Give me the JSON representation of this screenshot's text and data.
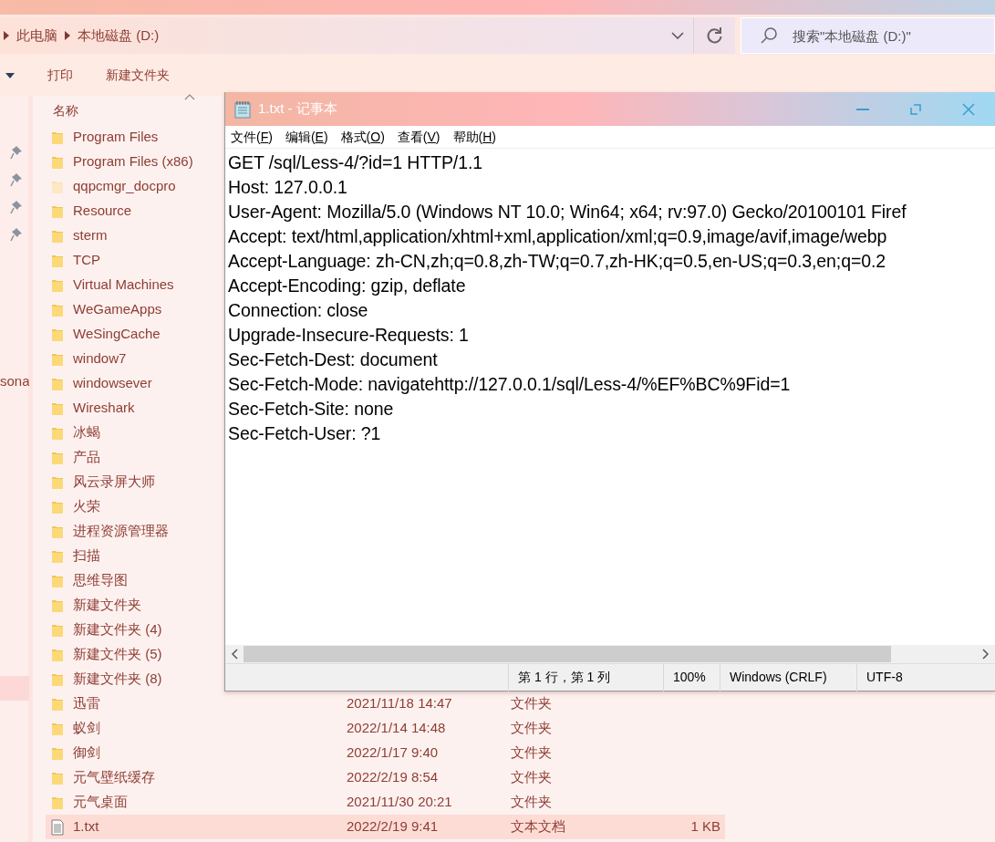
{
  "explorer": {
    "breadcrumb": [
      {
        "label": "此电脑"
      },
      {
        "label": "本地磁盘 (D:)"
      }
    ],
    "search": {
      "placeholder": "搜索\"本地磁盘 (D:)\""
    },
    "toolbar": [
      "打印",
      "新建文件夹"
    ],
    "nav_items": [
      {
        "label": "sona",
        "selected": false
      },
      {
        "selected": true
      }
    ],
    "column_header": "名称",
    "files": [
      {
        "name": "Program Files",
        "kind": "folder",
        "hidden": false,
        "selected": false
      },
      {
        "name": "Program Files (x86)",
        "kind": "folder",
        "hidden": false,
        "selected": false
      },
      {
        "name": "qqpcmgr_docpro",
        "kind": "folder",
        "hidden": true,
        "selected": false
      },
      {
        "name": "Resource",
        "kind": "folder",
        "hidden": false,
        "selected": false
      },
      {
        "name": "sterm",
        "kind": "folder",
        "hidden": false,
        "selected": false
      },
      {
        "name": "TCP",
        "kind": "folder",
        "hidden": false,
        "selected": false
      },
      {
        "name": "Virtual Machines",
        "kind": "folder",
        "hidden": false,
        "selected": false
      },
      {
        "name": "WeGameApps",
        "kind": "folder",
        "hidden": false,
        "selected": false
      },
      {
        "name": "WeSingCache",
        "kind": "folder",
        "hidden": false,
        "selected": false
      },
      {
        "name": "window7",
        "kind": "folder",
        "hidden": false,
        "selected": false
      },
      {
        "name": "windowsever",
        "kind": "folder",
        "hidden": false,
        "selected": false
      },
      {
        "name": "Wireshark",
        "kind": "folder",
        "hidden": false,
        "selected": false
      },
      {
        "name": "冰蝎",
        "kind": "folder",
        "hidden": false,
        "selected": false
      },
      {
        "name": "产品",
        "kind": "folder",
        "hidden": false,
        "selected": false
      },
      {
        "name": "风云录屏大师",
        "kind": "folder",
        "hidden": false,
        "selected": false
      },
      {
        "name": "火荣",
        "kind": "folder",
        "hidden": false,
        "selected": false
      },
      {
        "name": "进程资源管理器",
        "kind": "folder",
        "hidden": false,
        "selected": false
      },
      {
        "name": "扫描",
        "kind": "folder",
        "hidden": false,
        "selected": false
      },
      {
        "name": "思维导图",
        "kind": "folder",
        "hidden": false,
        "selected": false
      },
      {
        "name": "新建文件夹",
        "kind": "folder",
        "hidden": false,
        "selected": false
      },
      {
        "name": "新建文件夹 (4)",
        "kind": "folder",
        "hidden": false,
        "selected": false
      },
      {
        "name": "新建文件夹 (5)",
        "kind": "folder",
        "hidden": false,
        "selected": false
      },
      {
        "name": "新建文件夹 (8)",
        "kind": "folder",
        "hidden": false,
        "selected": false
      },
      {
        "name": "迅雷",
        "kind": "folder",
        "hidden": false,
        "selected": false,
        "date": "2021/11/18 14:47",
        "type": "文件夹"
      },
      {
        "name": "蚁剑",
        "kind": "folder",
        "hidden": false,
        "selected": false,
        "date": "2022/1/14 14:48",
        "type": "文件夹"
      },
      {
        "name": "御剑",
        "kind": "folder",
        "hidden": false,
        "selected": false,
        "date": "2022/1/17 9:40",
        "type": "文件夹"
      },
      {
        "name": "元气壁纸缓存",
        "kind": "folder",
        "hidden": false,
        "selected": false,
        "date": "2022/2/19 8:54",
        "type": "文件夹"
      },
      {
        "name": "元气桌面",
        "kind": "folder",
        "hidden": false,
        "selected": false,
        "date": "2021/11/30 20:21",
        "type": "文件夹"
      },
      {
        "name": "1.txt",
        "kind": "file",
        "hidden": false,
        "selected": true,
        "date": "2022/2/19 9:41",
        "type": "文本文档",
        "size": "1 KB"
      }
    ]
  },
  "notepad": {
    "title": "1.txt - 记事本",
    "menu": [
      {
        "before": "文件(",
        "key": "F",
        "after": ")"
      },
      {
        "before": "编辑(",
        "key": "E",
        "after": ")"
      },
      {
        "before": "格式(",
        "key": "O",
        "after": ")"
      },
      {
        "before": "查看(",
        "key": "V",
        "after": ")"
      },
      {
        "before": "帮助(",
        "key": "H",
        "after": ")"
      }
    ],
    "lines": [
      "GET /sql/Less-4/?id=1 HTTP/1.1",
      "Host: 127.0.0.1",
      "User-Agent: Mozilla/5.0 (Windows NT 10.0; Win64; x64; rv:97.0) Gecko/20100101 Firef",
      "Accept: text/html,application/xhtml+xml,application/xml;q=0.9,image/avif,image/webp",
      "Accept-Language: zh-CN,zh;q=0.8,zh-TW;q=0.7,zh-HK;q=0.5,en-US;q=0.3,en;q=0.2",
      "Accept-Encoding: gzip, deflate",
      "Connection: close",
      "Upgrade-Insecure-Requests: 1",
      "Sec-Fetch-Dest: document",
      "Sec-Fetch-Mode: navigatehttp://127.0.0.1/sql/Less-4/%EF%BC%9Fid=1",
      "Sec-Fetch-Site: none",
      "Sec-Fetch-User: ?1"
    ],
    "status": [
      "第 1 行，第 1 列",
      "100%",
      "Windows (CRLF)",
      "UTF-8"
    ]
  }
}
